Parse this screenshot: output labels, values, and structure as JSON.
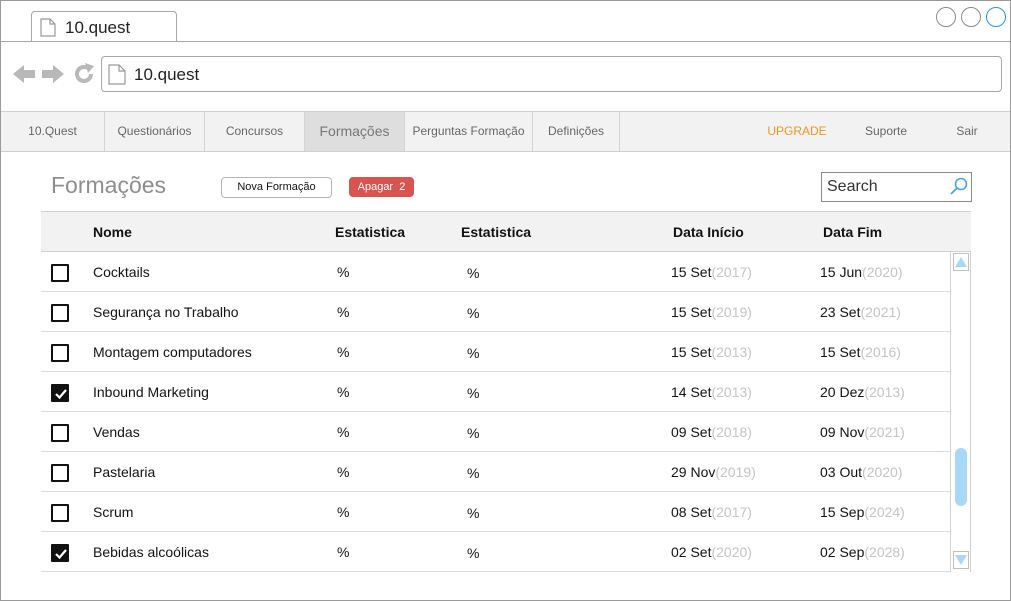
{
  "browser": {
    "tab_title": "10.quest",
    "url": "10.quest"
  },
  "menu": {
    "items": [
      {
        "label": "10.Quest"
      },
      {
        "label": "Questionários"
      },
      {
        "label": "Concursos"
      },
      {
        "label": "Formações",
        "active": true
      },
      {
        "label": "Perguntas Formação"
      },
      {
        "label": "Definições"
      }
    ],
    "upgrade": "UPGRADE",
    "support": "Suporte",
    "logout": "Sair"
  },
  "page": {
    "title": "Formações",
    "new_button": "Nova Formação",
    "delete_button": "Apagar",
    "delete_count": "2",
    "search_placeholder": "Search"
  },
  "colors": {
    "upgrade": "#f0961e",
    "delete": "#d9534f",
    "scroll_thumb": "#a8d8f8"
  },
  "table": {
    "headers": {
      "name": "Nome",
      "stat1": "Estatistica",
      "stat2": "Estatistica",
      "start": "Data Início",
      "end": "Data Fim"
    },
    "rows": [
      {
        "checked": false,
        "name": "Cocktails",
        "stat1": "%",
        "stat2": "%",
        "start": "15 Set",
        "start_year": "(2017)",
        "end": "15 Jun",
        "end_year": "(2020)"
      },
      {
        "checked": false,
        "name": "Segurança no Trabalho",
        "stat1": "%",
        "stat2": "%",
        "start": "15 Set",
        "start_year": "(2019)",
        "end": "23 Set",
        "end_year": "(2021)"
      },
      {
        "checked": false,
        "name": "Montagem computadores",
        "stat1": "%",
        "stat2": "%",
        "start": "15 Set",
        "start_year": "(2013)",
        "end": "15 Set",
        "end_year": "(2016)"
      },
      {
        "checked": true,
        "name": "Inbound Marketing",
        "stat1": "%",
        "stat2": "%",
        "start": "14 Set",
        "start_year": "(2013)",
        "end": "20 Dez",
        "end_year": "(2013)"
      },
      {
        "checked": false,
        "name": "Vendas",
        "stat1": "%",
        "stat2": "%",
        "start": "09 Set",
        "start_year": "(2018)",
        "end": "09 Nov",
        "end_year": "(2021)"
      },
      {
        "checked": false,
        "name": "Pastelaria",
        "stat1": "%",
        "stat2": "%",
        "start": "29 Nov",
        "start_year": "(2019)",
        "end": "03 Out",
        "end_year": "(2020)"
      },
      {
        "checked": false,
        "name": "Scrum",
        "stat1": "%",
        "stat2": "%",
        "start": "08 Set",
        "start_year": "(2017)",
        "end": "15 Sep",
        "end_year": "(2024)"
      },
      {
        "checked": true,
        "name": "Bebidas alcoólicas",
        "stat1": "%",
        "stat2": "%",
        "start": "02 Set",
        "start_year": "(2020)",
        "end": "02 Sep",
        "end_year": "(2028)"
      }
    ]
  }
}
